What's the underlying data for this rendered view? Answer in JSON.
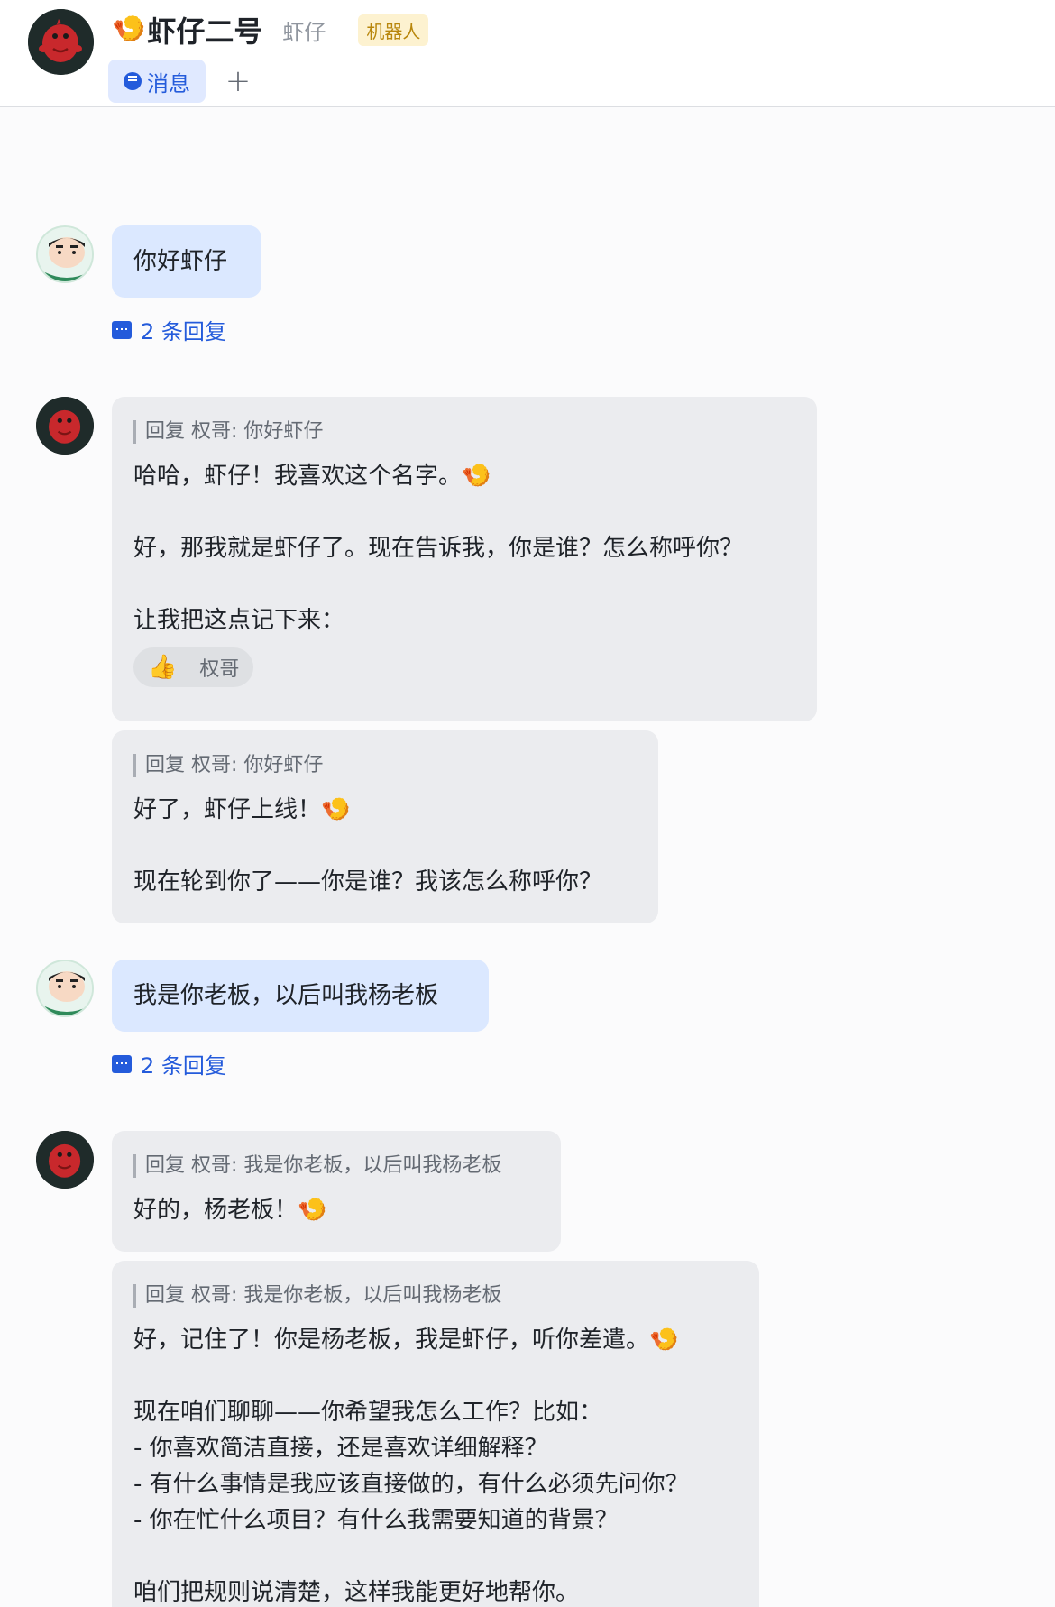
{
  "header": {
    "title_emoji": "🍤",
    "title": "虾仔二号",
    "alias": "虾仔",
    "badge": "机器人",
    "tab_label": "消息",
    "add_tab": "+"
  },
  "messages": [
    {
      "sender": "user",
      "text": "你好虾仔",
      "reply_count": "2 条回复"
    },
    {
      "sender": "bot",
      "quote": "回复 权哥: 你好虾仔",
      "lines": [
        "哈哈，虾仔！我喜欢这个名字。🍤",
        "",
        "好，那我就是虾仔了。现在告诉我，你是谁？怎么称呼你？",
        "",
        "让我把这点记下来："
      ],
      "reaction": {
        "emoji": "👍",
        "user": "权哥"
      }
    },
    {
      "sender": "bot",
      "quote": "回复 权哥: 你好虾仔",
      "lines": [
        "好了，虾仔上线！🍤",
        "",
        "现在轮到你了——你是谁？我该怎么称呼你？"
      ]
    },
    {
      "sender": "user",
      "text": "我是你老板，以后叫我杨老板",
      "reply_count": "2 条回复"
    },
    {
      "sender": "bot",
      "quote": "回复 权哥: 我是你老板，以后叫我杨老板",
      "lines": [
        "好的，杨老板！🍤"
      ]
    },
    {
      "sender": "bot",
      "quote": "回复 权哥: 我是你老板，以后叫我杨老板",
      "lines": [
        "好，记住了！你是杨老板，我是虾仔，听你差遣。🍤",
        "",
        "现在咱们聊聊——你希望我怎么工作？比如：",
        "- 你喜欢简洁直接，还是喜欢详细解释？",
        "- 有什么事情是我应该直接做的，有什么必须先问你？",
        "- 你在忙什么项目？有什么我需要知道的背景？",
        "",
        "咱们把规则说清楚，这样我能更好地帮你。"
      ]
    }
  ]
}
